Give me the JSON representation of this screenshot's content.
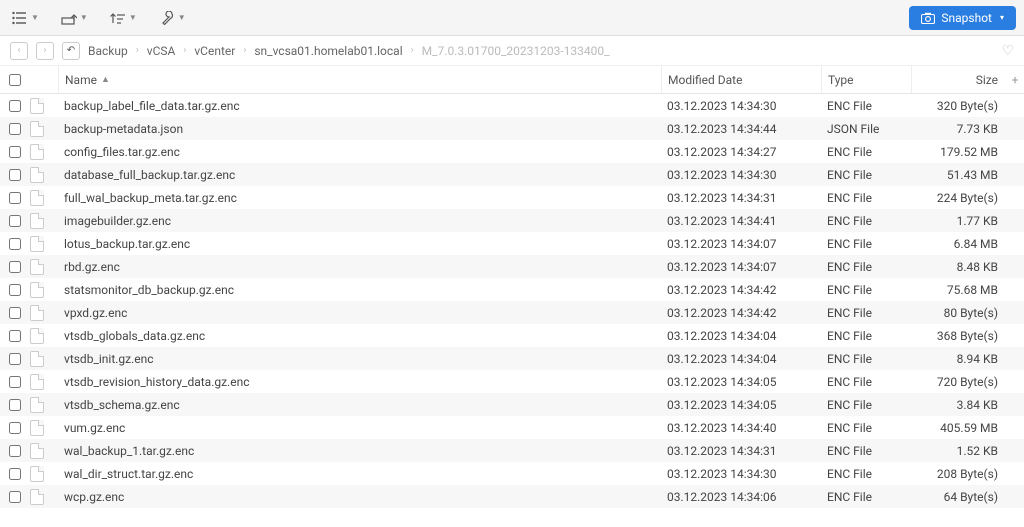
{
  "toolbar": {
    "snapshot_label": "Snapshot"
  },
  "breadcrumb": {
    "segments": [
      "Backup",
      "vCSA",
      "vCenter",
      "sn_vcsa01.homelab01.local"
    ],
    "current": "M_7.0.3.01700_20231203-133400_"
  },
  "columns": {
    "name": "Name",
    "modified": "Modified Date",
    "type": "Type",
    "size": "Size"
  },
  "files": [
    {
      "name": "backup_label_file_data.tar.gz.enc",
      "modified": "03.12.2023 14:34:30",
      "type": "ENC File",
      "size": "320 Byte(s)"
    },
    {
      "name": "backup-metadata.json",
      "modified": "03.12.2023 14:34:44",
      "type": "JSON File",
      "size": "7.73 KB"
    },
    {
      "name": "config_files.tar.gz.enc",
      "modified": "03.12.2023 14:34:27",
      "type": "ENC File",
      "size": "179.52 MB"
    },
    {
      "name": "database_full_backup.tar.gz.enc",
      "modified": "03.12.2023 14:34:30",
      "type": "ENC File",
      "size": "51.43 MB"
    },
    {
      "name": "full_wal_backup_meta.tar.gz.enc",
      "modified": "03.12.2023 14:34:31",
      "type": "ENC File",
      "size": "224 Byte(s)"
    },
    {
      "name": "imagebuilder.gz.enc",
      "modified": "03.12.2023 14:34:41",
      "type": "ENC File",
      "size": "1.77 KB"
    },
    {
      "name": "lotus_backup.tar.gz.enc",
      "modified": "03.12.2023 14:34:07",
      "type": "ENC File",
      "size": "6.84 MB"
    },
    {
      "name": "rbd.gz.enc",
      "modified": "03.12.2023 14:34:07",
      "type": "ENC File",
      "size": "8.48 KB"
    },
    {
      "name": "statsmonitor_db_backup.gz.enc",
      "modified": "03.12.2023 14:34:42",
      "type": "ENC File",
      "size": "75.68 MB"
    },
    {
      "name": "vpxd.gz.enc",
      "modified": "03.12.2023 14:34:42",
      "type": "ENC File",
      "size": "80 Byte(s)"
    },
    {
      "name": "vtsdb_globals_data.gz.enc",
      "modified": "03.12.2023 14:34:04",
      "type": "ENC File",
      "size": "368 Byte(s)"
    },
    {
      "name": "vtsdb_init.gz.enc",
      "modified": "03.12.2023 14:34:04",
      "type": "ENC File",
      "size": "8.94 KB"
    },
    {
      "name": "vtsdb_revision_history_data.gz.enc",
      "modified": "03.12.2023 14:34:05",
      "type": "ENC File",
      "size": "720 Byte(s)"
    },
    {
      "name": "vtsdb_schema.gz.enc",
      "modified": "03.12.2023 14:34:05",
      "type": "ENC File",
      "size": "3.84 KB"
    },
    {
      "name": "vum.gz.enc",
      "modified": "03.12.2023 14:34:40",
      "type": "ENC File",
      "size": "405.59 MB"
    },
    {
      "name": "wal_backup_1.tar.gz.enc",
      "modified": "03.12.2023 14:34:31",
      "type": "ENC File",
      "size": "1.52 KB"
    },
    {
      "name": "wal_dir_struct.tar.gz.enc",
      "modified": "03.12.2023 14:34:30",
      "type": "ENC File",
      "size": "208 Byte(s)"
    },
    {
      "name": "wcp.gz.enc",
      "modified": "03.12.2023 14:34:06",
      "type": "ENC File",
      "size": "64 Byte(s)"
    }
  ]
}
